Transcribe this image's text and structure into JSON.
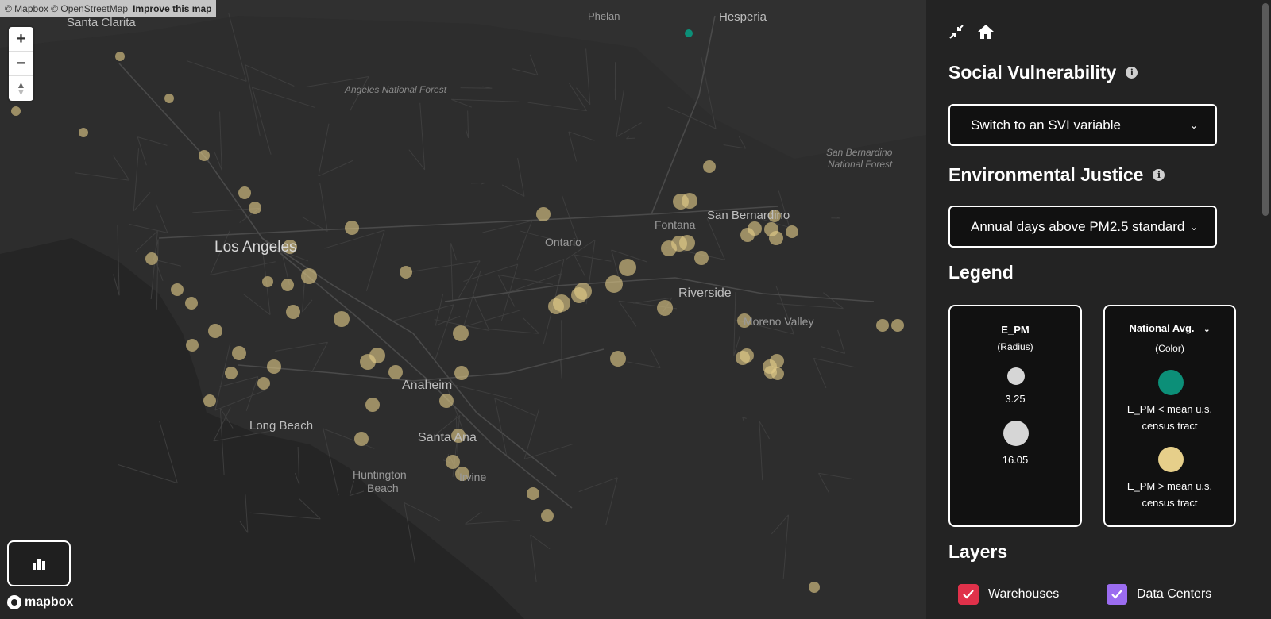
{
  "map": {
    "attribution": "© Mapbox © OpenStreetMap",
    "improve_link": "Improve this map",
    "zoom_in": "+",
    "zoom_out": "−",
    "compass": "▲",
    "logo_text": "mapbox",
    "labels": {
      "santa_clarita": "Santa Clarita",
      "phelan": "Phelan",
      "hesperia": "Hesperia",
      "angeles_forest": "Angeles National Forest",
      "sb_forest_1": "San Bernardino",
      "sb_forest_2": "National Forest",
      "los_angeles": "Los Angeles",
      "ontario": "Ontario",
      "fontana": "Fontana",
      "san_bernardino": "San Bernardino",
      "riverside": "Riverside",
      "moreno_valley": "Moreno Valley",
      "anaheim": "Anaheim",
      "long_beach": "Long Beach",
      "santa_ana": "Santa Ana",
      "huntington_1": "Huntington",
      "huntington_2": "Beach",
      "irvine": "Irvine"
    },
    "colors": {
      "above": "#e6cf8a",
      "below": "#0c8f78"
    }
  },
  "panel": {
    "social_title": "Social Vulnerability",
    "svi_select": "Switch to an SVI variable",
    "ej_title": "Environmental Justice",
    "ej_select": "Annual days above PM2.5 standard",
    "legend_title": "Legend",
    "radius_box": {
      "title": "E_PM",
      "subtitle": "(Radius)",
      "small_value": "3.25",
      "large_value": "16.05"
    },
    "color_box": {
      "title": "National Avg.",
      "subtitle": "(Color)",
      "below_text": "E_PM < mean u.s. census tract",
      "above_text": "E_PM > mean u.s. census tract"
    },
    "layers_title": "Layers",
    "layers": [
      {
        "label": "Warehouses",
        "color": "#e0314a"
      },
      {
        "label": "Data Centers",
        "color": "#9b6cf0"
      }
    ]
  }
}
